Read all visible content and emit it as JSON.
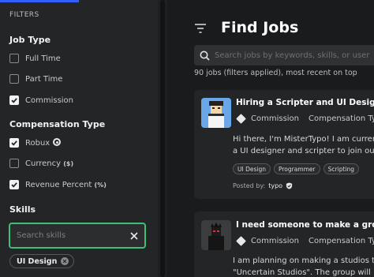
{
  "filters": {
    "heading": "FILTERS",
    "job_type": {
      "title": "Job Type",
      "options": [
        {
          "label": "Full Time",
          "checked": false
        },
        {
          "label": "Part Time",
          "checked": false
        },
        {
          "label": "Commission",
          "checked": true
        }
      ]
    },
    "compensation_type": {
      "title": "Compensation Type",
      "options": [
        {
          "label": "Robux",
          "checked": true
        },
        {
          "label": "Currency",
          "suffix": "($)",
          "checked": false
        },
        {
          "label": "Revenue Percent",
          "suffix": "(%)",
          "checked": true
        }
      ]
    },
    "skills": {
      "title": "Skills",
      "search_placeholder": "Search skills",
      "selected": [
        "UI Design"
      ]
    }
  },
  "main": {
    "title": "Find Jobs",
    "search_placeholder": "Search jobs by keywords, skills, or user",
    "results_text": "90 jobs (filters applied), most recent on top",
    "jobs": [
      {
        "title": "Hiring a Scripter and UI Designer!",
        "payment": "Commission",
        "compensation": "Compensation Type",
        "description": [
          "Hi there, I'm MisterTypo! I am currently",
          "a UI designer and scripter to join our team"
        ],
        "tags": [
          "UI Design",
          "Programmer",
          "Scripting"
        ],
        "posted_by_label": "Posted by:",
        "posted_by": "typo"
      },
      {
        "title": "I need someone to make a group logo",
        "payment": "Commission",
        "compensation": "Compensation Type",
        "description": [
          "I am planning on making a studios type group",
          "\"Uncertain Studios\". The group will be"
        ]
      }
    ]
  },
  "colors": {
    "accent_blue": "#335fff",
    "focus_green": "#3dbf76",
    "panel_bg": "#232527",
    "page_bg": "#191b1d"
  },
  "icons": [
    "filter-icon",
    "search-icon",
    "close-icon",
    "check-icon",
    "robux-icon",
    "diamond-icon",
    "verified-icon"
  ]
}
